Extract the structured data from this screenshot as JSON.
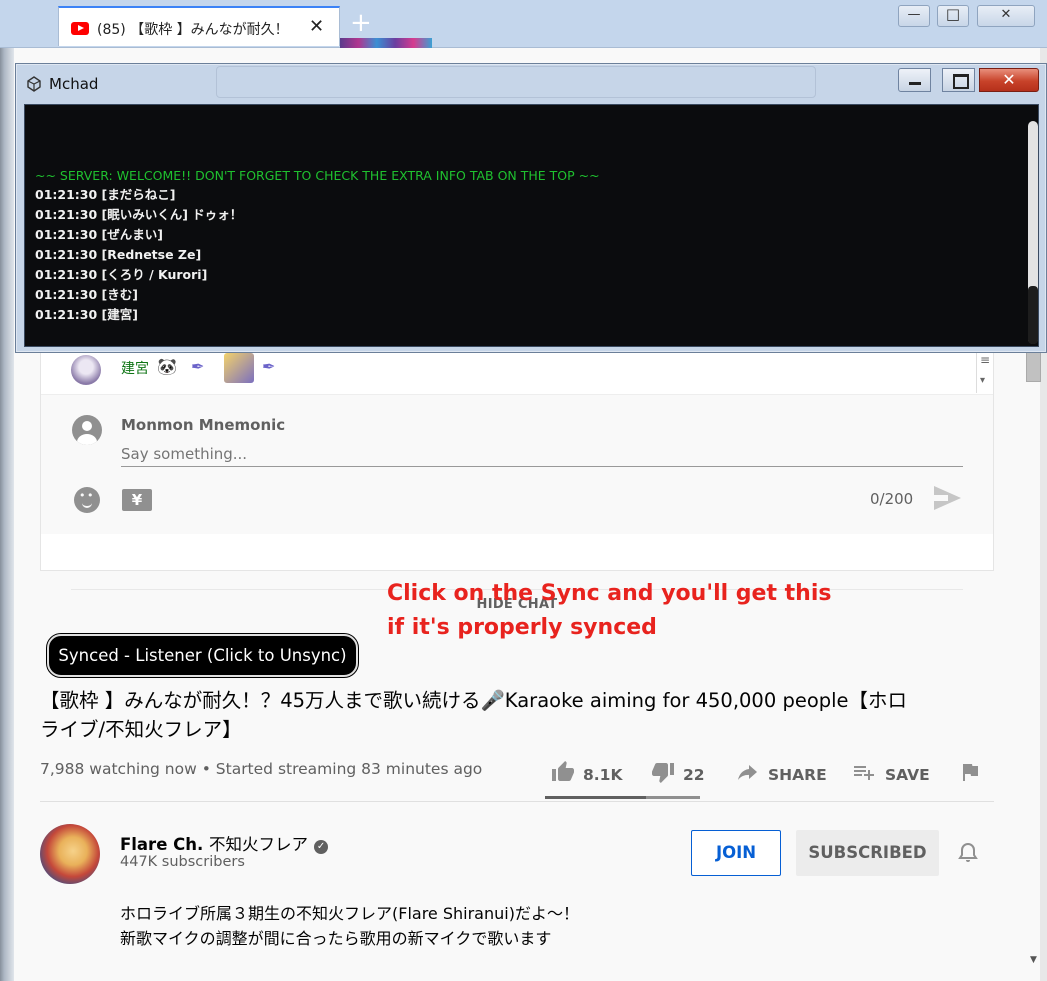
{
  "browser": {
    "tab_title": "(85) 【歌枠 】みんなが耐久！",
    "tab_close": "✕",
    "new_tab": "+"
  },
  "mchad": {
    "title": "Mchad",
    "close_glyph": "✕",
    "server_message": "~~ SERVER: WELCOME!! DON'T FORGET TO CHECK THE EXTRA INFO TAB ON THE TOP ~~",
    "lines": [
      "01:21:30 [まだらねこ]",
      "01:21:30 [眠いみいくん] ドゥォ！",
      "01:21:30 [ぜんまい]",
      "01:21:30 [Rednetse Ze]",
      "01:21:30 [くろり / Kurori]",
      "01:21:30 [きむ]",
      "01:21:30 [建宮]"
    ]
  },
  "chat": {
    "last_message_author": "建宮",
    "user_name": "Monmon Mnemonic",
    "input_placeholder": "Say something...",
    "money_glyph": "¥",
    "char_count": "0/200",
    "hide_chat_label": "HIDE CHAT"
  },
  "annotation": {
    "line1": "Click on the Sync and you'll get this",
    "line2": "if it's properly synced"
  },
  "sync_button": {
    "label": "Synced - Listener (Click to Unsync)"
  },
  "video": {
    "title_line1": "【歌枠 】みんなが耐久！？45万人まで歌い続ける🎤Karaoke aiming for 450,000 people【ホロ",
    "title_line2": "ライブ/不知火フレア】",
    "meta": "7,988 watching now • Started streaming 83 minutes ago",
    "likes": "8.1K",
    "dislikes": "22",
    "like_ratio": 0.65,
    "share_label": "SHARE",
    "save_label": "SAVE"
  },
  "channel": {
    "name": "Flare Ch.",
    "name_jp": "不知火フレア",
    "verified_glyph": "✓",
    "subscribers": "447K subscribers",
    "join_label": "JOIN",
    "subscribed_label": "SUBSCRIBED",
    "description_line1": "ホロライブ所属３期生の不知火フレア(Flare Shiranui)だよ～！",
    "description_line2": "新歌マイクの調整が間に合ったら歌用の新マイクで歌います"
  },
  "colors": {
    "chat_name_green": "#107516",
    "server_green": "#1fc12f",
    "annotation_red": "#e8231e",
    "link_blue": "#065fd4"
  },
  "icons": [
    "youtube-icon",
    "close-icon",
    "plus-icon",
    "mchad-logo-icon",
    "avatar-icon",
    "emoji-icon",
    "money-icon",
    "send-icon",
    "thumbs-up-icon",
    "thumbs-down-icon",
    "share-icon",
    "playlist-add-icon",
    "flag-icon",
    "verified-icon",
    "bell-icon"
  ]
}
